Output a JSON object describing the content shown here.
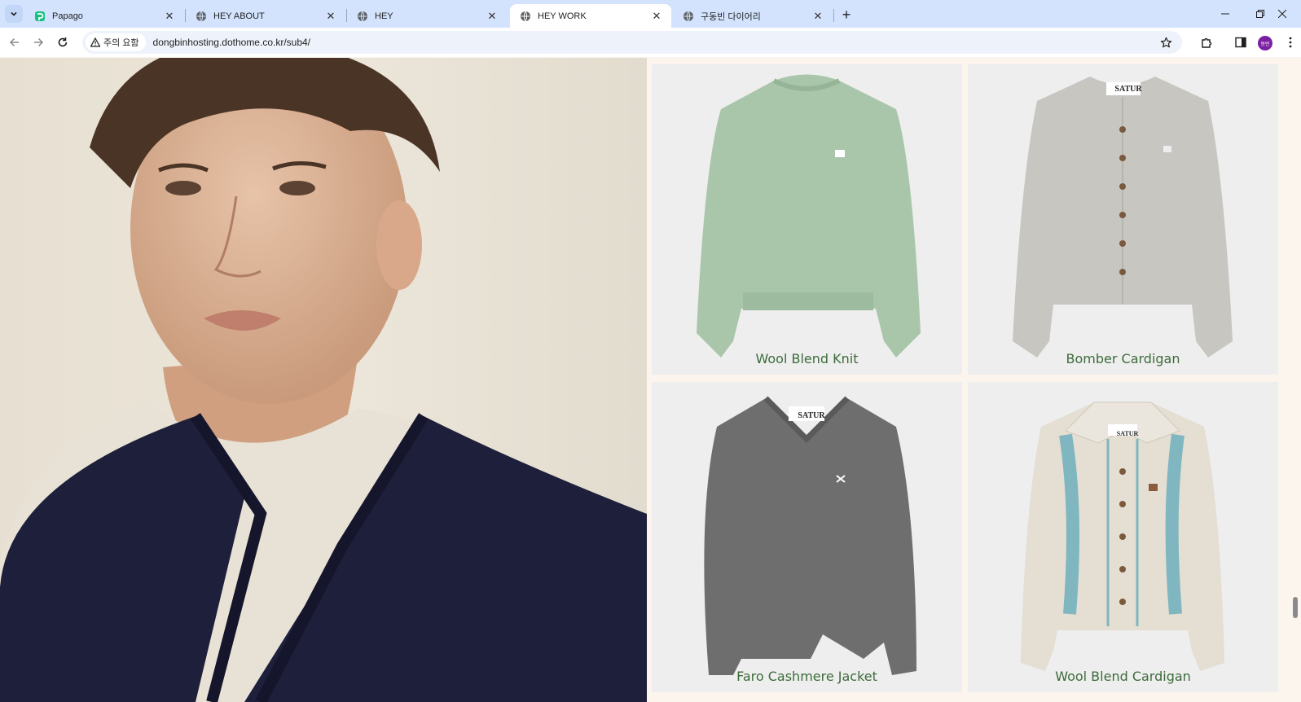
{
  "browser": {
    "tabs": [
      {
        "title": "Papago",
        "favicon": "papago-icon",
        "active": false
      },
      {
        "title": "HEY ABOUT",
        "favicon": "globe-icon",
        "active": false
      },
      {
        "title": "HEY",
        "favicon": "globe-icon",
        "active": false
      },
      {
        "title": "HEY WORK",
        "favicon": "globe-icon",
        "active": true
      },
      {
        "title": "구동빈 다이어리",
        "favicon": "globe-icon",
        "active": false
      }
    ],
    "tab_close_glyph": "✕",
    "new_tab_glyph": "+",
    "security_label": "주의 요함",
    "url": "dongbinhosting.dothome.co.kr/sub4/",
    "avatar_initials": "동빈",
    "window_controls": {
      "minimize": "—",
      "restore": "❐",
      "close": "✕"
    }
  },
  "products": [
    {
      "name": "Wool Blend Knit",
      "color": "#a9c6aa"
    },
    {
      "name": "Bomber Cardigan",
      "color": "#c8c6c1"
    },
    {
      "name": "Faro Cashmere Jacket",
      "color": "#6e6e6e"
    },
    {
      "name": "Wool Blend Cardigan",
      "color": "#e4ded3"
    }
  ],
  "brand_label": "SATUR",
  "colors": {
    "tab_strip": "#d3e3fd",
    "page_bg": "#fbf5ee",
    "card_bg": "#eeeeee",
    "product_text": "#3d6b3b",
    "vest": "#1e1f3a",
    "tshirt": "#e8e2d6"
  }
}
